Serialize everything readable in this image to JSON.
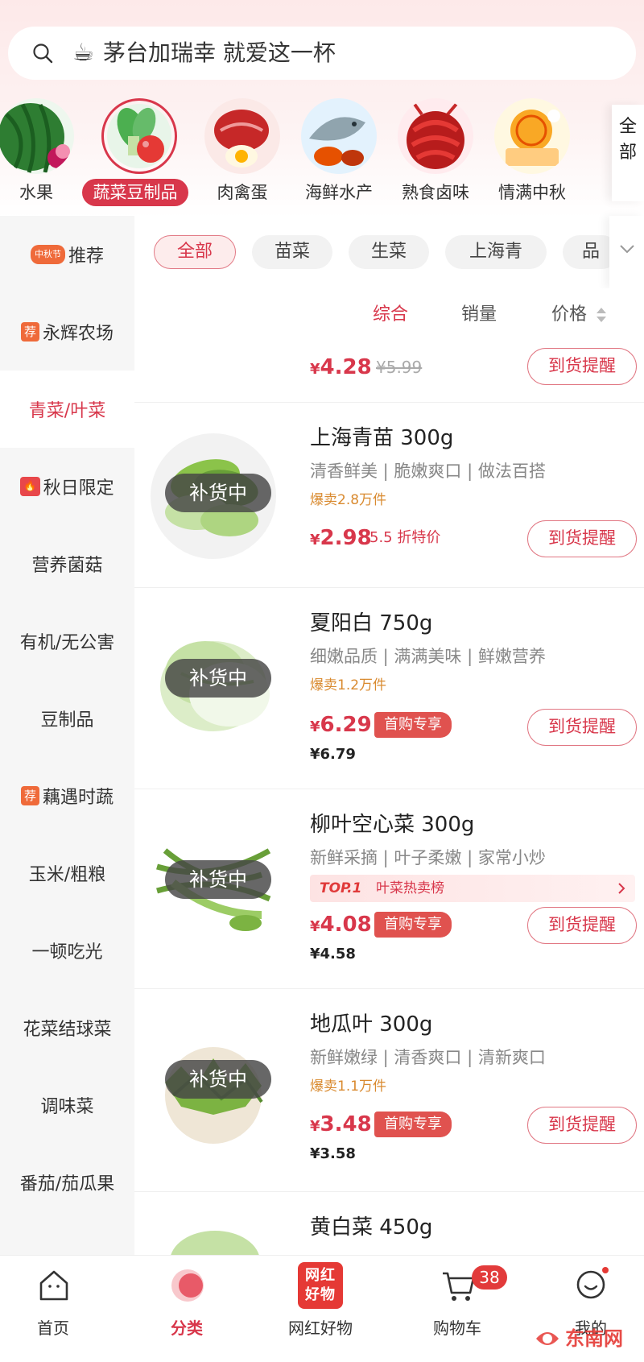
{
  "search": {
    "icon": "search-icon",
    "emoji": "☕",
    "text": "茅台加瑞幸 就爱这一杯"
  },
  "categories": [
    {
      "label": "水果",
      "icon": "watermelon-image"
    },
    {
      "label": "蔬菜豆制品",
      "icon": "vegetable-image",
      "active": true
    },
    {
      "label": "肉禽蛋",
      "icon": "meat-egg-image"
    },
    {
      "label": "海鲜水产",
      "icon": "seafood-image"
    },
    {
      "label": "熟食卤味",
      "icon": "crayfish-image"
    },
    {
      "label": "情满中秋",
      "icon": "mooncake-image"
    }
  ],
  "all_categories_label": "全部",
  "sidebar": [
    {
      "badge": "中秋节",
      "label": "推荐"
    },
    {
      "badge": "荐",
      "label": "永辉农场"
    },
    {
      "badge": "",
      "label": "青菜/叶菜",
      "active": true
    },
    {
      "badge": "🔥",
      "label": "秋日限定"
    },
    {
      "badge": "",
      "label": "营养菌菇"
    },
    {
      "badge": "",
      "label": "有机/无公害"
    },
    {
      "badge": "",
      "label": "豆制品"
    },
    {
      "badge": "荐",
      "label": "藕遇时蔬"
    },
    {
      "badge": "",
      "label": "玉米/粗粮"
    },
    {
      "badge": "",
      "label": "一顿吃光"
    },
    {
      "badge": "",
      "label": "花菜结球菜"
    },
    {
      "badge": "",
      "label": "调味菜"
    },
    {
      "badge": "",
      "label": "番茄/茄瓜果"
    }
  ],
  "chips": [
    "全部",
    "苗菜",
    "生菜",
    "上海青",
    "品"
  ],
  "sort": {
    "comprehensive": "综合",
    "sales": "销量",
    "price": "价格"
  },
  "products": [
    {
      "title": "",
      "price": "4.28",
      "strike": "¥5.99",
      "notify": "到货提醒"
    },
    {
      "title": "上海青苗 300g",
      "desc": "清香鲜美 | 脆嫩爽口 | 做法百搭",
      "sold": "爆卖2.8万件",
      "price": "2.98",
      "discount": "5.5 折特价",
      "restock": "补货中",
      "notify": "到货提醒"
    },
    {
      "title": "夏阳白 750g",
      "desc": "细嫩品质 | 满满美味 | 鲜嫩营养",
      "sold": "爆卖1.2万件",
      "price": "6.29",
      "tag": "首购专享",
      "old_price": "¥6.79",
      "restock": "补货中",
      "notify": "到货提醒"
    },
    {
      "title": "柳叶空心菜 300g",
      "desc": "新鲜采摘 | 叶子柔嫩 | 家常小炒",
      "rank_top": "TOP.1",
      "rank_text": "叶菜热卖榜",
      "price": "4.08",
      "tag": "首购专享",
      "old_price": "¥4.58",
      "restock": "补货中",
      "notify": "到货提醒"
    },
    {
      "title": "地瓜叶 300g",
      "desc": "新鲜嫩绿 | 清香爽口 | 清新爽口",
      "sold": "爆卖1.1万件",
      "price": "3.48",
      "tag": "首购专享",
      "old_price": "¥3.58",
      "restock": "补货中",
      "notify": "到货提醒"
    },
    {
      "title": "黄白菜 450g"
    }
  ],
  "currency": "¥",
  "tabbar": [
    {
      "label": "首页",
      "icon": "home-icon"
    },
    {
      "label": "分类",
      "icon": "category-icon",
      "active": true
    },
    {
      "label": "网红好物",
      "icon": "wanghong-icon",
      "icon_text": "网红好物"
    },
    {
      "label": "购物车",
      "icon": "cart-icon",
      "badge": "38"
    },
    {
      "label": "我的",
      "icon": "profile-icon"
    }
  ],
  "watermark": "东南网",
  "colors": {
    "accent": "#d8374b",
    "sold": "#d98a2f",
    "header_bg": "#fde9e9"
  }
}
